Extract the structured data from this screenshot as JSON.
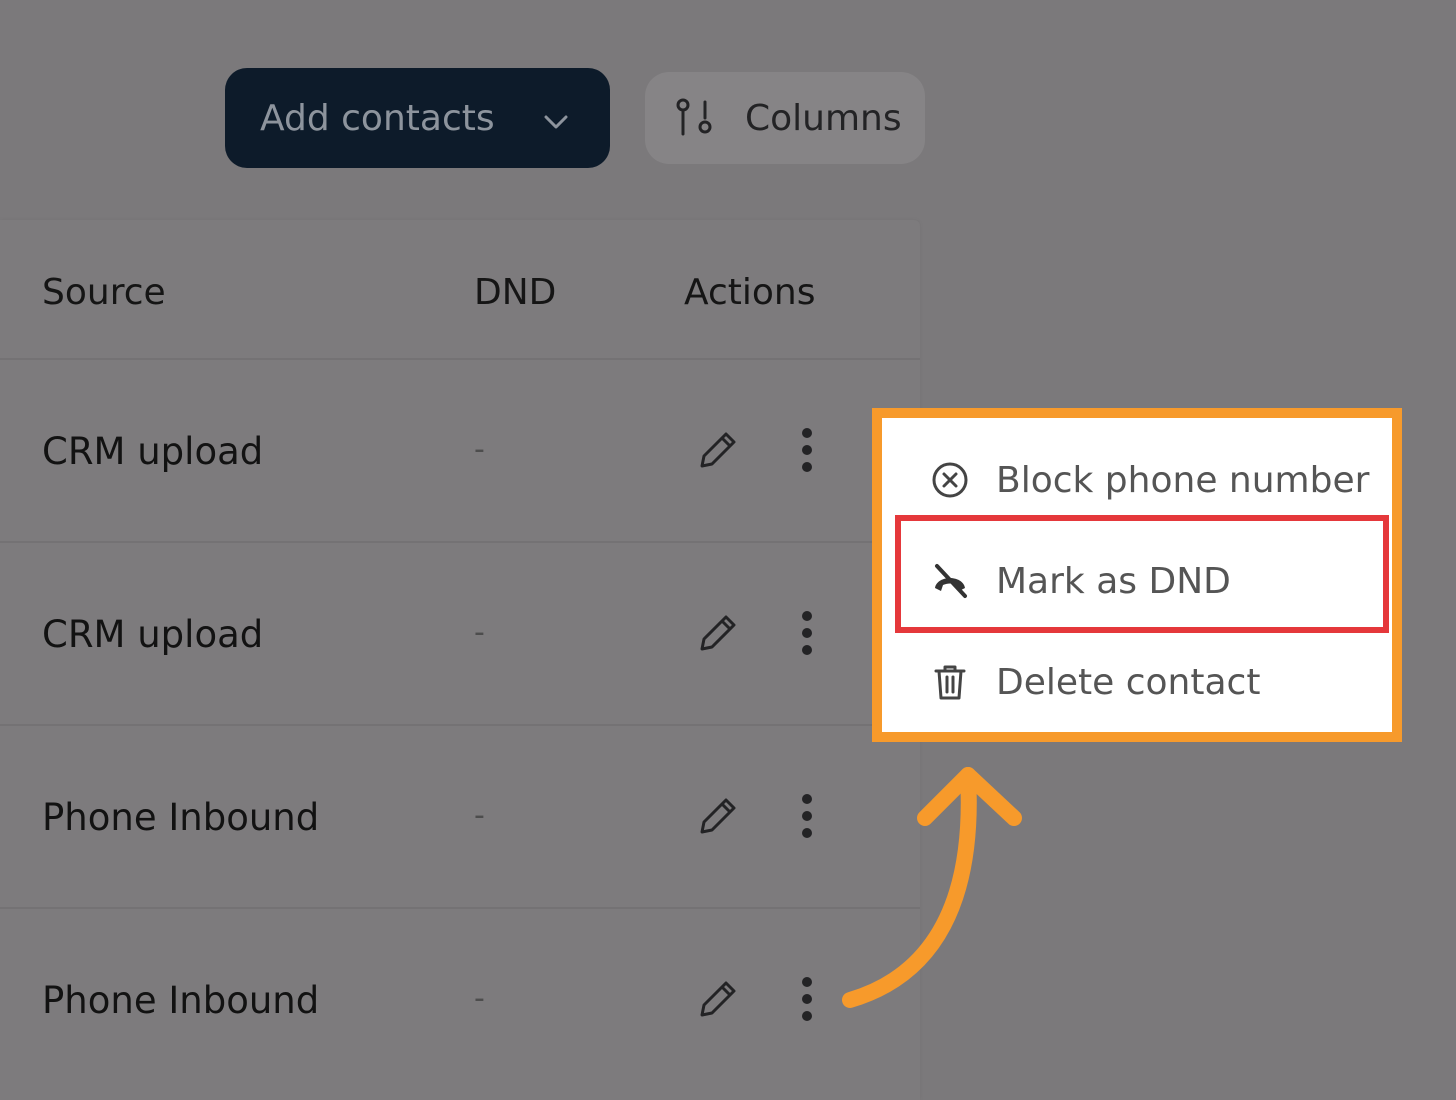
{
  "toolbar": {
    "add_contacts_label": "Add contacts",
    "columns_label": "Columns"
  },
  "table": {
    "headers": [
      "Source",
      "DND",
      "Actions"
    ],
    "rows": [
      {
        "source": "CRM upload",
        "dnd": "-"
      },
      {
        "source": "CRM upload",
        "dnd": "-"
      },
      {
        "source": "Phone Inbound",
        "dnd": "-"
      },
      {
        "source": "Phone Inbound",
        "dnd": "-"
      }
    ]
  },
  "context_menu": {
    "items": [
      {
        "label": "Block phone number",
        "icon": "block-circle-icon"
      },
      {
        "label": "Mark as DND",
        "icon": "phone-off-icon"
      },
      {
        "label": "Delete contact",
        "icon": "trash-icon"
      }
    ]
  },
  "annotation": {
    "frame_color": "#f79a2b",
    "highlight_color": "#e5383b",
    "highlighted_item": "Mark as DND"
  }
}
